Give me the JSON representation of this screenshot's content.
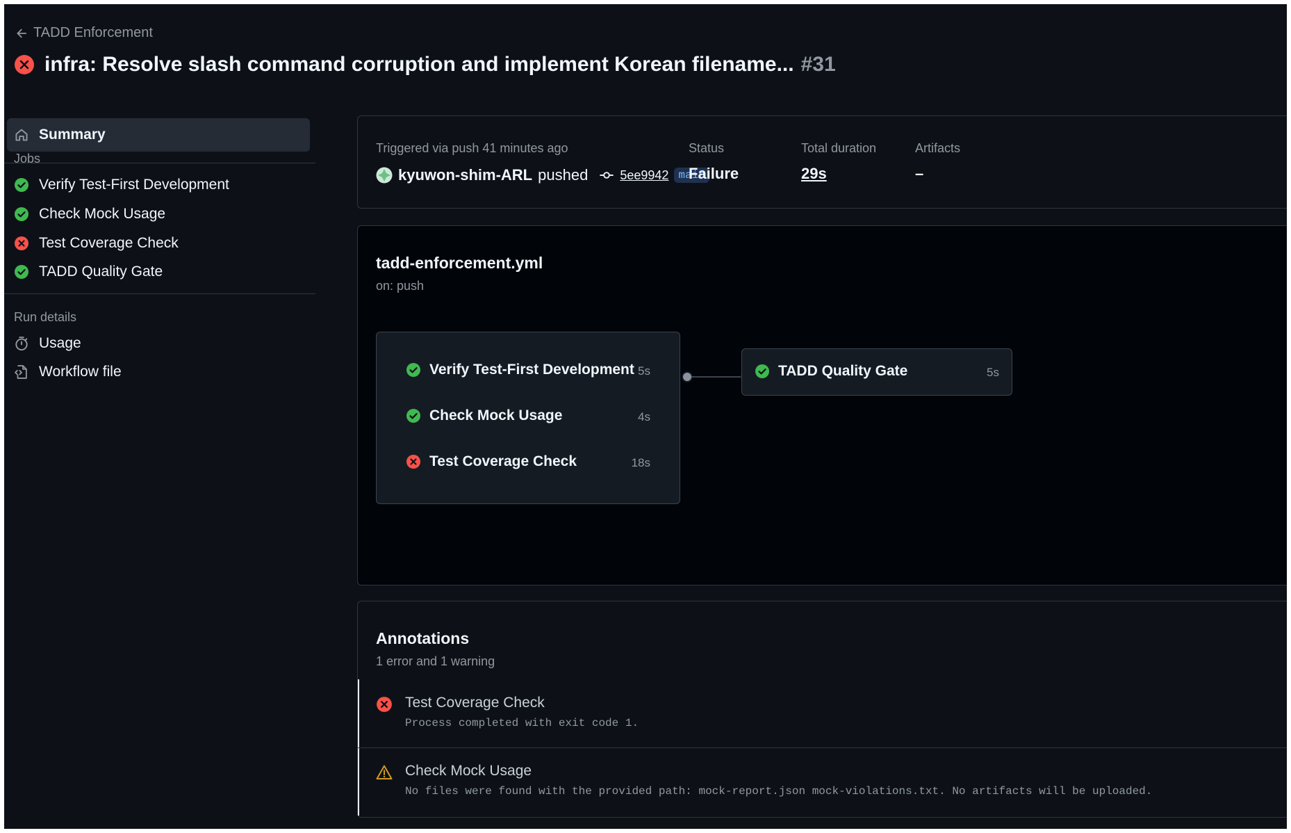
{
  "header": {
    "back_label": "TADD Enforcement",
    "title": "infra: Resolve slash command corruption and implement Korean filename...",
    "run_number": "#31"
  },
  "sidebar": {
    "summary_label": "Summary",
    "jobs_heading": "Jobs",
    "jobs": [
      {
        "label": "Verify Test-First Development",
        "status": "success"
      },
      {
        "label": "Check Mock Usage",
        "status": "success"
      },
      {
        "label": "Test Coverage Check",
        "status": "failure"
      },
      {
        "label": "TADD Quality Gate",
        "status": "success"
      }
    ],
    "run_details_heading": "Run details",
    "usage_label": "Usage",
    "workflow_file_label": "Workflow file"
  },
  "summary": {
    "triggered_label": "Triggered via push 41 minutes ago",
    "actor": "kyuwon-shim-ARL",
    "pushed_word": "pushed",
    "commit": "5ee9942",
    "branch": "main",
    "status_label": "Status",
    "status_value": "Failure",
    "duration_label": "Total duration",
    "duration_value": "29s",
    "artifacts_label": "Artifacts",
    "artifacts_value": "–"
  },
  "workflow": {
    "file": "tadd-enforcement.yml",
    "trigger": "on: push",
    "group_jobs": [
      {
        "label": "Verify Test-First Development",
        "duration": "5s",
        "status": "success"
      },
      {
        "label": "Check Mock Usage",
        "duration": "4s",
        "status": "success"
      },
      {
        "label": "Test Coverage Check",
        "duration": "18s",
        "status": "failure"
      }
    ],
    "final_job": {
      "label": "TADD Quality Gate",
      "duration": "5s",
      "status": "success"
    }
  },
  "annotations": {
    "title": "Annotations",
    "subtitle": "1 error and 1 warning",
    "items": [
      {
        "type": "error",
        "title": "Test Coverage Check",
        "message": "Process completed with exit code 1."
      },
      {
        "type": "warning",
        "title": "Check Mock Usage",
        "message": "No files were found with the provided path: mock-report.json mock-violations.txt. No artifacts will be uploaded."
      }
    ]
  },
  "colors": {
    "success": "#3fb950",
    "failure": "#f85149",
    "warning": "#d29922",
    "background": "#0d1117"
  }
}
